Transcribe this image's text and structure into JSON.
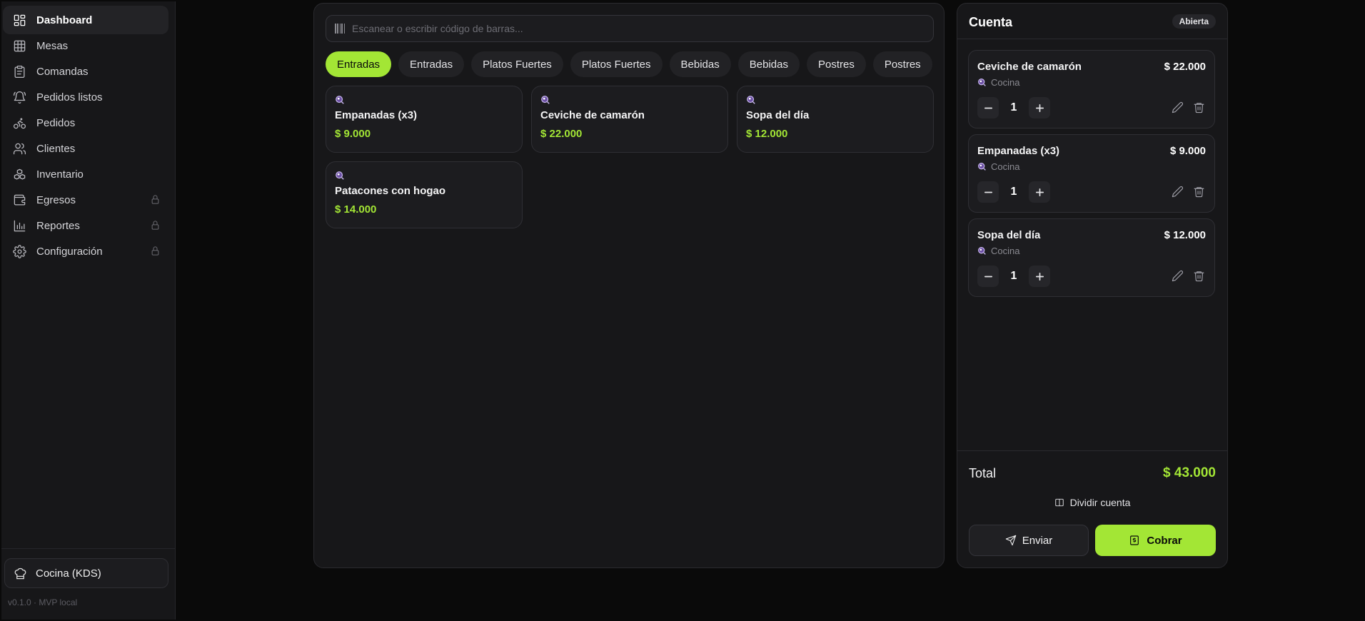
{
  "sidebar": {
    "items": [
      {
        "label": "Dashboard",
        "icon": "dashboard-icon",
        "active": true
      },
      {
        "label": "Mesas",
        "icon": "grid-table-icon"
      },
      {
        "label": "Comandas",
        "icon": "clipboard-icon"
      },
      {
        "label": "Pedidos listos",
        "icon": "bell-icon"
      },
      {
        "label": "Pedidos",
        "icon": "bike-icon"
      },
      {
        "label": "Clientes",
        "icon": "users-icon"
      },
      {
        "label": "Inventario",
        "icon": "boxes-icon"
      },
      {
        "label": "Egresos",
        "icon": "wallet-icon",
        "locked": true
      },
      {
        "label": "Reportes",
        "icon": "bar-chart-icon",
        "locked": true
      },
      {
        "label": "Configuración",
        "icon": "gear-icon",
        "locked": true
      }
    ],
    "kitchen_button": "Cocina (KDS)",
    "version": "v0.1.0 · MVP local"
  },
  "search": {
    "placeholder": "Escanear o escribir código de barras..."
  },
  "categories": [
    "Entradas",
    "Entradas",
    "Platos Fuertes",
    "Platos Fuertes",
    "Bebidas",
    "Bebidas",
    "Postres",
    "Postres"
  ],
  "active_category": 0,
  "products": [
    {
      "name": "Empanadas (x3)",
      "price": "$ 9.000"
    },
    {
      "name": "Ceviche de camarón",
      "price": "$ 22.000"
    },
    {
      "name": "Sopa del día",
      "price": "$ 12.000"
    },
    {
      "name": "Patacones con hogao",
      "price": "$ 14.000"
    }
  ],
  "account": {
    "title": "Cuenta",
    "status": "Abierta",
    "items": [
      {
        "name": "Ceviche de camarón",
        "price": "$ 22.000",
        "station": "Cocina",
        "qty": "1"
      },
      {
        "name": "Empanadas (x3)",
        "price": "$ 9.000",
        "station": "Cocina",
        "qty": "1"
      },
      {
        "name": "Sopa del día",
        "price": "$ 12.000",
        "station": "Cocina",
        "qty": "1"
      }
    ],
    "total_label": "Total",
    "total_value": "$ 43.000",
    "split_label": "Dividir cuenta",
    "send_label": "Enviar",
    "pay_label": "Cobrar"
  },
  "colors": {
    "accent": "#a3e635",
    "background": "#0a0a0a",
    "panel": "#171719"
  }
}
